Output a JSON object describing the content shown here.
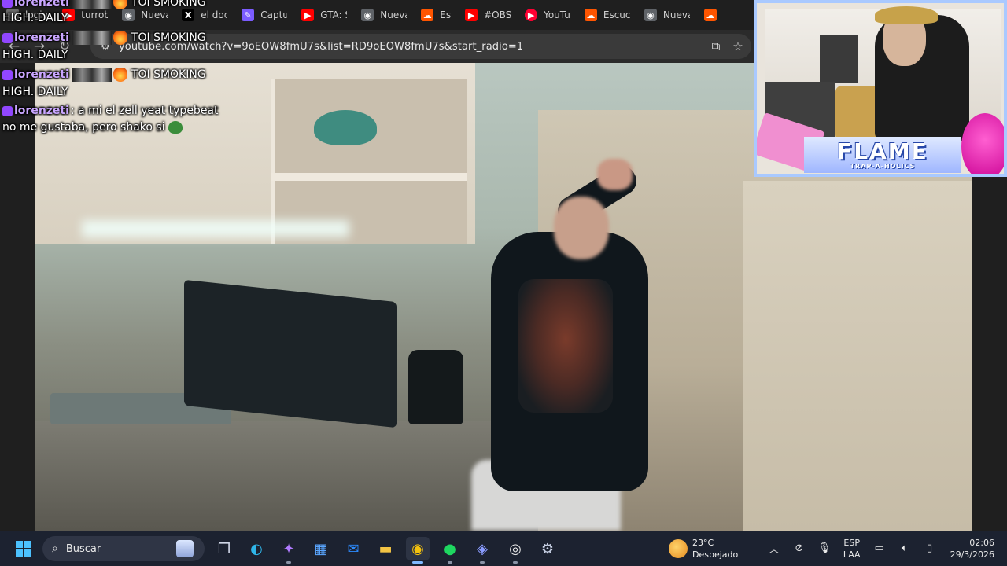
{
  "browser": {
    "tabs": [
      {
        "label": "login",
        "icon": "globe-icon",
        "color": "#6b6b6b"
      },
      {
        "label": "turrob",
        "icon": "youtube-icon",
        "color": "#ff0000"
      },
      {
        "label": "Nueva",
        "icon": "chrome-icon",
        "color": "#5f6368"
      },
      {
        "label": "el doc",
        "icon": "x-icon",
        "color": "#000000"
      },
      {
        "label": "Captu",
        "icon": "pen-icon",
        "color": "#7b5cff"
      },
      {
        "label": "GTA: S",
        "icon": "youtube-icon",
        "color": "#ff0000"
      },
      {
        "label": "Nueva",
        "icon": "chrome-icon",
        "color": "#5f6368"
      },
      {
        "label": "Es",
        "icon": "soundcloud-icon",
        "color": "#ff5500"
      },
      {
        "label": "#OBS",
        "icon": "youtube-icon",
        "color": "#ff0000"
      },
      {
        "label": "YouTu",
        "icon": "youtube-music-icon",
        "color": "#ff0033"
      },
      {
        "label": "Escuc",
        "icon": "soundcloud-icon",
        "color": "#ff5500"
      },
      {
        "label": "Nueva",
        "icon": "chrome-icon",
        "color": "#5f6368"
      },
      {
        "label": "",
        "icon": "soundcloud-icon",
        "color": "#ff5500"
      }
    ],
    "url": "youtube.com/watch?v=9oEOW8fmU7s&list=RD9oEOW8fmU7s&start_radio=1"
  },
  "chat": {
    "messages": [
      {
        "user": "lorenzeti",
        "text": "TOI SMOKING",
        "line2": "HIGH. DAILY"
      },
      {
        "user": "lorenzeti",
        "text": "TOI SMOKING",
        "line2": "HIGH. DAILY"
      },
      {
        "user": "lorenzeti",
        "text": "TOI SMOKING",
        "line2": "HIGH. DAILY"
      },
      {
        "user": "lorenzeti",
        "text": ": a mi el zell yeat typebeat",
        "line2": "no me gustaba, pero shako si"
      }
    ]
  },
  "webcam": {
    "banner_title": "FLAME",
    "banner_subtitle": "TRAP-A-HOLICS"
  },
  "taskbar": {
    "search_label": "Buscar",
    "weather_temp": "23°C",
    "weather_desc": "Despejado",
    "lang_top": "ESP",
    "lang_bottom": "LAA",
    "time": "02:06",
    "date": "29/3/2026",
    "accent": "#1c2230"
  }
}
